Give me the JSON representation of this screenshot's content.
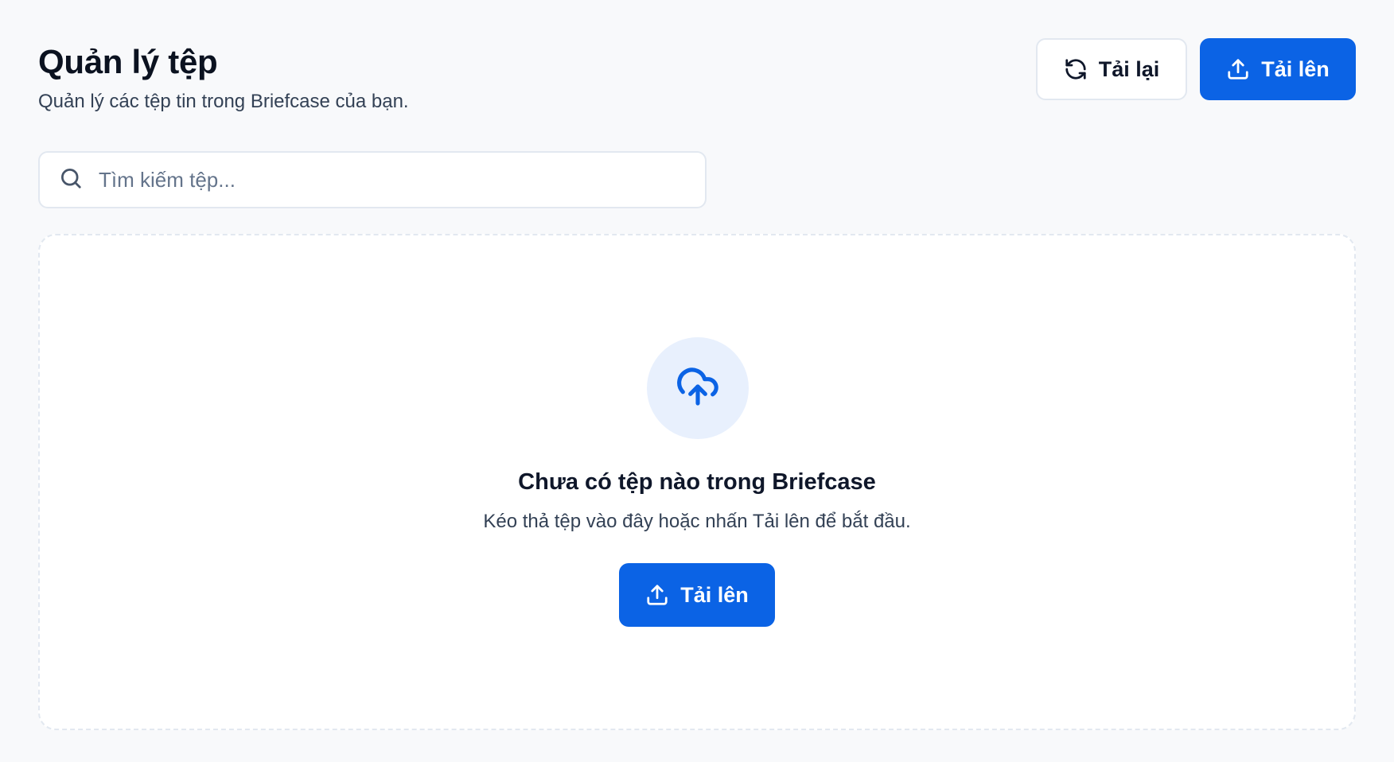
{
  "header": {
    "title": "Quản lý tệp",
    "subtitle": "Quản lý các tệp tin trong Briefcase của bạn."
  },
  "toolbar": {
    "reload_label": "Tải lại",
    "reload_icon": "refresh-icon",
    "upload_label": "Tải lên",
    "upload_icon": "upload-icon"
  },
  "search": {
    "placeholder": "Tìm kiếm tệp...",
    "value": "",
    "icon": "search-icon"
  },
  "empty_state": {
    "icon": "cloud-upload-icon",
    "title": "Chưa có tệp nào trong Briefcase",
    "description": "Kéo thả tệp vào đây hoặc nhấn Tải lên để bắt đầu.",
    "upload_label": "Tải lên"
  },
  "colors": {
    "primary": "#0b63e5",
    "background": "#f8f9fb",
    "icon_circle": "#e8f0fd",
    "border": "#e2e8f0"
  }
}
